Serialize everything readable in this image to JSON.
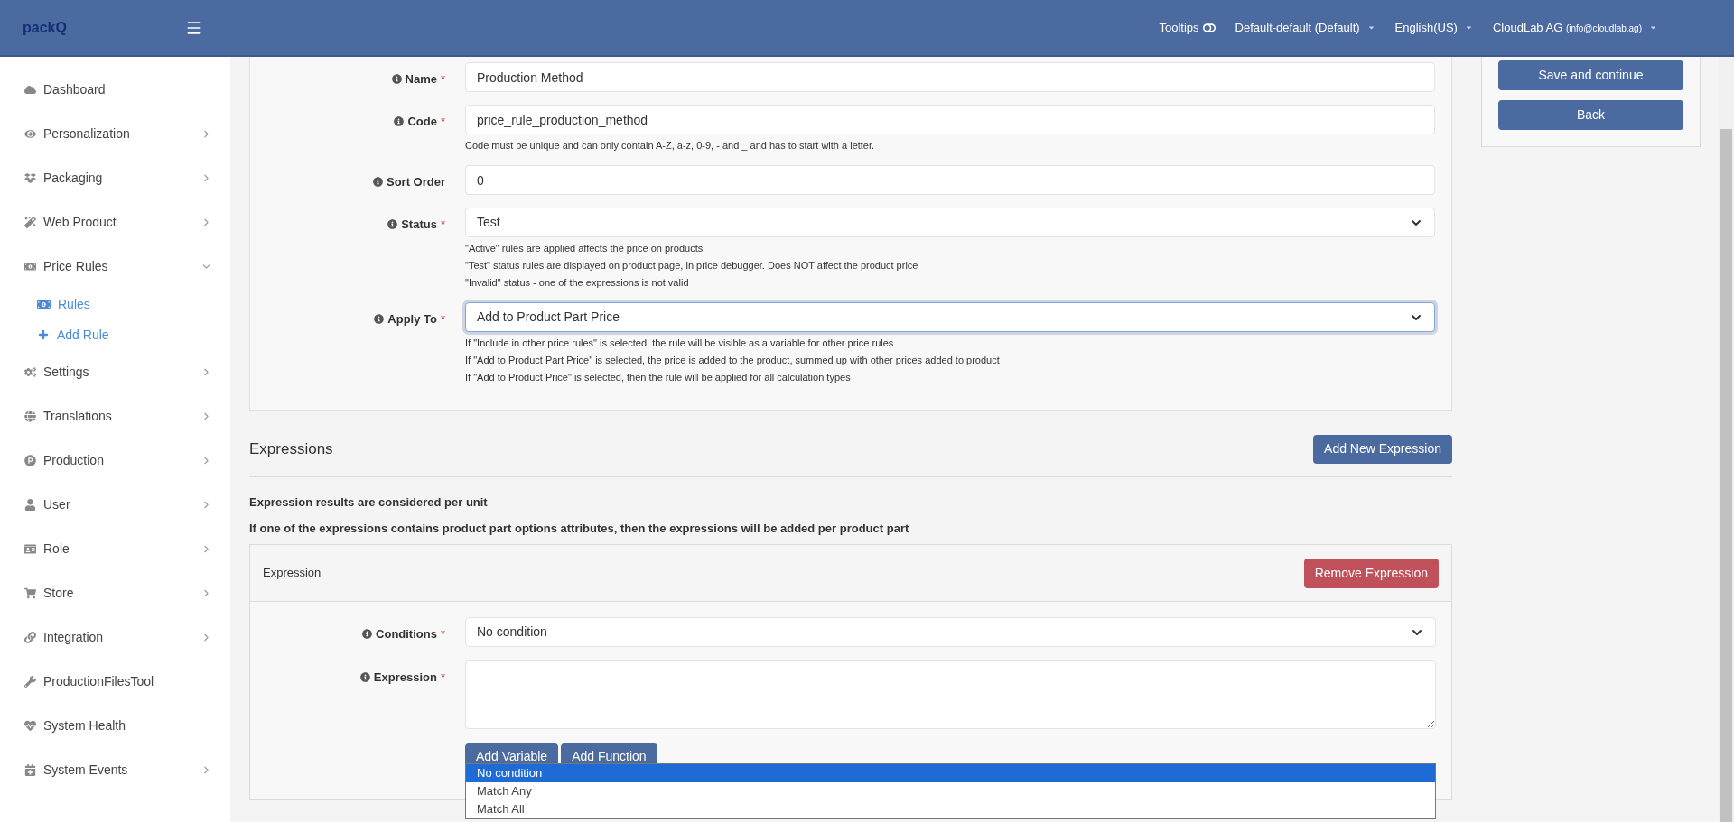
{
  "topbar": {
    "logo": "packQ",
    "tooltips": {
      "label": "Tooltips",
      "on": false
    },
    "dropdowns": [
      "Default-default (Default)",
      "English(US)"
    ],
    "user": {
      "name": "CloudLab AG",
      "email": "(info@cloudlab.ag)"
    }
  },
  "sidebar": {
    "items": [
      {
        "label": "Dashboard"
      },
      {
        "label": "Personalization",
        "expanded": false
      },
      {
        "label": "Packaging",
        "expanded": false
      },
      {
        "label": "Web Product",
        "expanded": false
      },
      {
        "label": "Price Rules",
        "expanded": true,
        "children": [
          {
            "label": "Rules",
            "kind": "list"
          },
          {
            "label": "Add Rule",
            "kind": "add"
          }
        ]
      },
      {
        "label": "Settings",
        "expanded": false
      },
      {
        "label": "Translations",
        "expanded": false
      },
      {
        "label": "Production",
        "expanded": false
      },
      {
        "label": "User",
        "expanded": false
      },
      {
        "label": "Role",
        "expanded": false
      },
      {
        "label": "Store",
        "expanded": false
      },
      {
        "label": "Integration",
        "expanded": false
      },
      {
        "label": "ProductionFilesTool"
      },
      {
        "label": "System Health"
      },
      {
        "label": "System Events",
        "expanded": false
      }
    ]
  },
  "form": {
    "fields": [
      {
        "label": "Name",
        "marker": "*",
        "kind": "input",
        "value": "Production Method",
        "focused": false
      },
      {
        "label": "Code",
        "marker": "*",
        "kind": "input",
        "value": "price_rule_production_method",
        "focused": false,
        "help": [
          "Code must be unique and can only contain A-Z, a-z, 0-9, - and _ and has to start with a letter."
        ]
      },
      {
        "label": "Sort Order",
        "kind": "input",
        "value": "0",
        "focused": false
      },
      {
        "label": "Status",
        "marker": "*",
        "kind": "select",
        "value": "Test",
        "focused": false,
        "help": [
          "\"Active\" rules are applied affects the price on products",
          "\"Test\" status rules are displayed on product page, in price debugger. Does NOT affect the product price",
          "\"Invalid\" status - one of the expressions is not valid"
        ]
      },
      {
        "label": "Apply To",
        "marker": "*",
        "kind": "select",
        "value": "Add to Product Part Price",
        "focused": true,
        "help": [
          "If \"Include in other price rules\" is selected, the rule will be visible as a variable for other price rules",
          "If \"Add to Product Part Price\" is selected, the price is added to the product, summed up with other prices added to product",
          "If \"Add to Product Price\" is selected, then the rule will be applied for all calculation types"
        ]
      }
    ]
  },
  "actions": [
    "Save and continue",
    "Back"
  ],
  "expressions": {
    "title": "Expressions",
    "add_button": "Add New Expression",
    "notes": [
      "Expression results are considered per unit",
      "If one of the expressions contains product part options attributes, then the expressions will be added per product part"
    ],
    "expression": {
      "title": "Expression",
      "remove_button": "Remove Expression",
      "fields": [
        {
          "label": "Conditions",
          "marker": "*",
          "kind": "select",
          "value": "No condition"
        },
        {
          "label": "Expression",
          "marker": "*",
          "kind": "textarea"
        }
      ],
      "buttons": [
        "Add Variable",
        "Add Function"
      ],
      "dropdown_options": [
        {
          "label": "No condition",
          "selected": true
        },
        {
          "label": "Match Any",
          "selected": false
        },
        {
          "label": "Match All",
          "selected": false
        }
      ]
    }
  }
}
